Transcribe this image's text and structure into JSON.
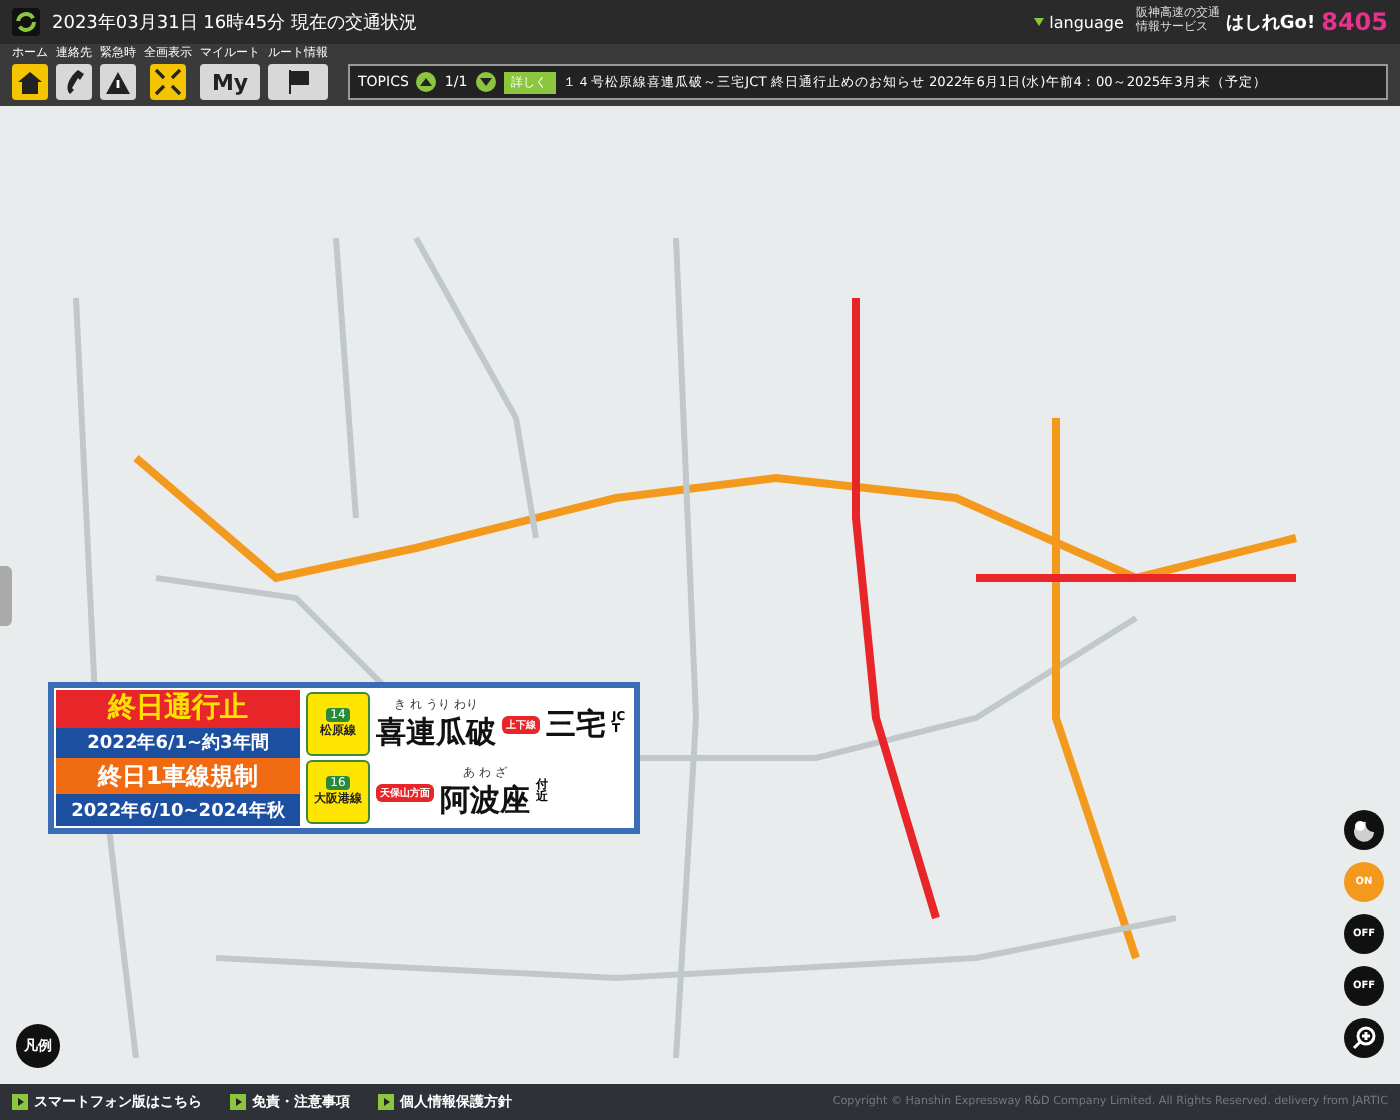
{
  "header": {
    "title": "2023年03月31日 16時45分 現在の交通状況",
    "language": "language",
    "logo_caption": "阪神高速の交通情報サービス",
    "logo_text": "はしれGo!",
    "logo_number": "8405"
  },
  "toolbar": [
    {
      "label": "ホーム",
      "kind": "home",
      "selected": true
    },
    {
      "label": "連絡先",
      "kind": "phone",
      "selected": false
    },
    {
      "label": "緊急時",
      "kind": "warning",
      "selected": false
    },
    {
      "label": "全画表示",
      "kind": "expand",
      "selected": true
    },
    {
      "label": "マイルート",
      "kind": "my",
      "text": "My",
      "selected": false
    },
    {
      "label": "ルート情報",
      "kind": "flag",
      "selected": false
    }
  ],
  "topics": {
    "label": "TOPICS",
    "page": "1/1",
    "detail_button": "詳しく",
    "message": "１４号松原線喜連瓜破～三宅JCT 終日通行止めのお知らせ 2022年6月1日(水)午前4：00～2025年3月末（予定）"
  },
  "notice": {
    "closure_title": "終日通行止",
    "closure_period": "2022年6/1~約3年間",
    "restriction_title": "終日1車線規制",
    "restriction_period": "2022年6/10~2024年秋",
    "routes": [
      {
        "number": "14",
        "name": "松原線",
        "ruby": "き れ うり わり",
        "place": "喜連瓜破",
        "direction": "上下線",
        "destination": "三宅",
        "suffix": "JCT"
      },
      {
        "number": "16",
        "name": "大阪港線",
        "ruby": "あ わ ざ",
        "place": "阿波座",
        "direction": "天保山方面",
        "suffix": "付近"
      }
    ]
  },
  "map_controls": [
    {
      "kind": "day-night",
      "on": false
    },
    {
      "kind": "target",
      "on": true,
      "text": "ON"
    },
    {
      "kind": "camera",
      "on": false,
      "text": "OFF"
    },
    {
      "kind": "video",
      "on": false,
      "text": "OFF"
    },
    {
      "kind": "zoom"
    }
  ],
  "legend_button": "凡例",
  "footer": {
    "links": [
      "スマートフォン版はこちら",
      "免責・注意事項",
      "個人情報保護方針"
    ],
    "copyright": "Copyright © Hanshin Expressway R&D Company Limited. All Rights Reserved. delivery from JARTIC"
  }
}
